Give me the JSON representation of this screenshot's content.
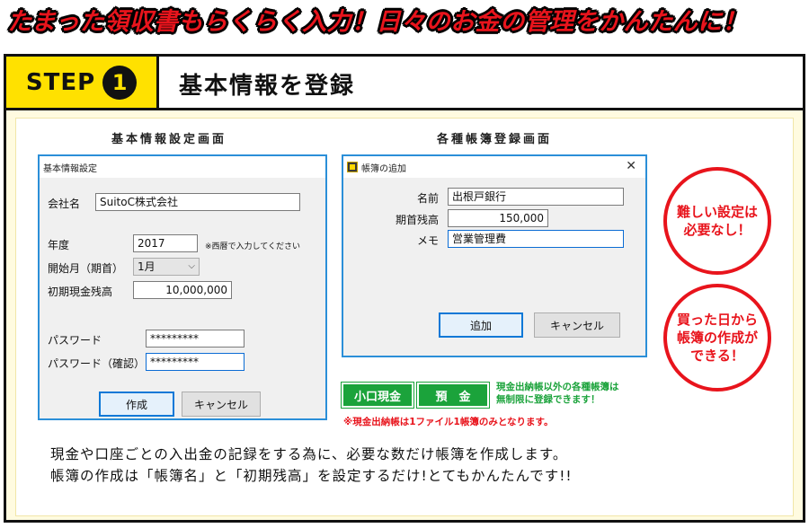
{
  "headline": "たまった領収書もらくらく入力！日々のお金の管理をかんたんに！",
  "step": {
    "label": "STEP",
    "number": "1",
    "title": "基本情報を登録"
  },
  "left_panel": {
    "caption": "基本情報設定画面",
    "window_title": "基本情報設定",
    "company_label": "会社名",
    "company_value": "SuitoC株式会社",
    "year_label": "年度",
    "year_value": "2017",
    "year_note": "※西暦で入力してください",
    "start_month_label": "開始月（期首）",
    "start_month_value": "1月",
    "initial_cash_label": "初期現金残高",
    "initial_cash_value": "10,000,000",
    "password_label": "パスワード",
    "password_value": "*********",
    "password_confirm_label": "パスワード（確認）",
    "password_confirm_value": "*********",
    "create_button": "作成",
    "cancel_button": "キャンセル"
  },
  "right_panel": {
    "caption": "各種帳簿登録画面",
    "window_title": "帳簿の追加",
    "name_label": "名前",
    "name_value": "出根戸銀行",
    "opening_label": "期首残高",
    "opening_value": "150,000",
    "memo_label": "メモ",
    "memo_value": "営業管理費",
    "add_button": "追加",
    "cancel_button": "キャンセル"
  },
  "tags": {
    "petty_cash": "小口現金",
    "deposit": "預　金",
    "desc_line1": "現金出納帳以外の各種帳簿は",
    "desc_line2": "無制限に登録できます！",
    "note": "※現金出納帳は1ファイル1帳簿のみとなります。"
  },
  "circles": {
    "top_line1": "難しい設定は",
    "top_line2": "必要なし！",
    "bottom_line1": "買った日から",
    "bottom_line2": "帳簿の作成が",
    "bottom_line3": "できる！"
  },
  "description": {
    "line1": "現金や口座ごとの入出金の記録をする為に、必要な数だけ帳簿を作成します。",
    "line2": "帳簿の作成は「帳簿名」と「初期残高」を設定するだけ!とてもかんたんです!!"
  },
  "colors": {
    "accent_red": "#e8141c",
    "step_yellow": "#ffe100",
    "tag_green": "#1ba33b",
    "window_border": "#2b8fd8"
  }
}
